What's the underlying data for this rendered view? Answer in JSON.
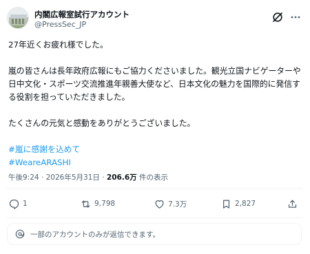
{
  "header": {
    "display_name": "内閣広報室試行アカウント",
    "handle": "@PressSec_JP"
  },
  "tweet": {
    "lines": [
      "27年近くお疲れ様でした。",
      "嵐の皆さんは長年政府広報にもご協力くださいました。観光立国ナビゲーターや日中文化・スポーツ交流推進年親善大使など、日本文化の魅力を国際的に発信する役割を担っていただきました。",
      "たくさんの元気と感動をありがとうございました。"
    ],
    "hashtags": [
      "#嵐に感謝を込めて",
      "#WeareARASHI"
    ]
  },
  "meta": {
    "time": "午後9:24",
    "separator": "·",
    "date": "2026年5月31日",
    "views": "206.6万",
    "views_suffix": " 件の表示"
  },
  "actions": {
    "reply_count": "1",
    "retweet_count": "9,798",
    "like_count": "7.3万",
    "bookmark_count": "2,827"
  },
  "reply_restriction": {
    "text": "一部のアカウントのみが返信できます。"
  },
  "colors": {
    "text": "#0f1419",
    "secondary": "#536471",
    "link": "#1d9bf0",
    "divider": "#eff3f4"
  },
  "icons": [
    "grok-icon",
    "more-options-icon",
    "reply-icon",
    "retweet-icon",
    "like-icon",
    "bookmark-icon",
    "share-icon",
    "at-mention-icon"
  ]
}
